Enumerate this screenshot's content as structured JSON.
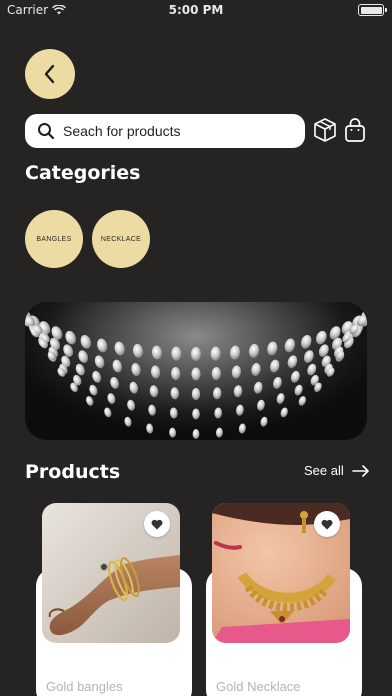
{
  "status_bar": {
    "carrier": "Carrier",
    "time": "5:00 PM"
  },
  "search": {
    "placeholder": "Seach for products"
  },
  "categories": {
    "title": "Categories",
    "items": [
      {
        "label": "BANGLES"
      },
      {
        "label": "NECKLACE"
      }
    ]
  },
  "products": {
    "title": "Products",
    "see_all": "See all",
    "items": [
      {
        "name": "Gold bangles"
      },
      {
        "name": "Gold Necklace"
      }
    ]
  },
  "colors": {
    "background": "#262423",
    "accent": "#ECDBA2",
    "card": "#FFFFFF"
  },
  "icons": [
    "back-arrow-icon",
    "search-icon",
    "box-icon",
    "shopping-bag-icon",
    "arrow-right-icon",
    "heart-icon",
    "wifi-icon",
    "battery-icon"
  ]
}
